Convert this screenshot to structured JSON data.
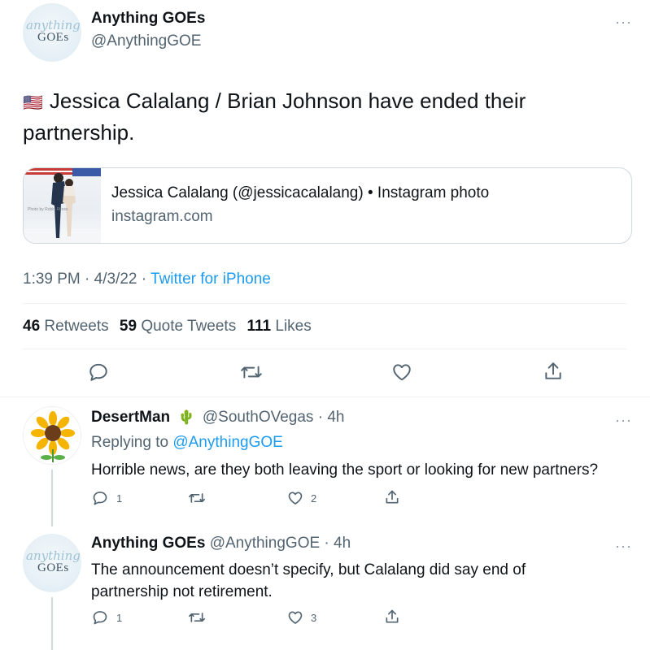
{
  "main_tweet": {
    "display_name": "Anything GOEs",
    "handle": "@AnythingGOE",
    "avatar_text": "GOEs",
    "avatar_script": "anything",
    "flag": "🇺🇸",
    "text": "Jessica Calalang / Brian Johnson have ended their partnership.",
    "link_card": {
      "title": "Jessica Calalang (@jessicacalalang) • Instagram photo",
      "domain": "instagram.com",
      "image_credit": "Photo by Robin Ritoss"
    },
    "time": "1:39 PM",
    "date": "4/3/22",
    "source": "Twitter for iPhone",
    "stats": {
      "retweets_count": "46",
      "retweets_label": "Retweets",
      "quotes_count": "59",
      "quotes_label": "Quote Tweets",
      "likes_count": "111",
      "likes_label": "Likes"
    }
  },
  "replies": [
    {
      "display_name": "DesertMan",
      "badge_emoji": "🌵",
      "handle": "@SouthOVegas",
      "time": "4h",
      "replying_prefix": "Replying to",
      "replying_to": "@AnythingGOE",
      "text": "Horrible news, are they both leaving the sport or looking for new partners?",
      "reply_count": "1",
      "retweet_count": "",
      "like_count": "2"
    },
    {
      "display_name": "Anything GOEs",
      "handle": "@AnythingGOE",
      "time": "4h",
      "text": "The announcement doesn’t specify, but Calalang did say end of partnership not retirement.",
      "reply_count": "1",
      "retweet_count": "",
      "like_count": "3"
    }
  ],
  "colors": {
    "accent": "#1d9bf0",
    "text": "#0f1419",
    "muted": "#536471",
    "divider": "#eff3f4"
  },
  "icons": [
    "more-horizontal-icon",
    "reply-icon",
    "retweet-icon",
    "like-icon",
    "share-icon",
    "cactus-icon",
    "sunflower-icon"
  ]
}
